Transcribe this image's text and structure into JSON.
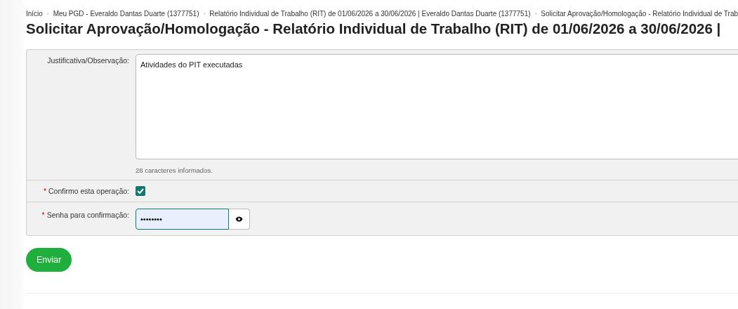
{
  "breadcrumb": [
    "Início",
    "Meu PGD - Everaldo Dantas Duarte (1377751)",
    "Relatório Individual de Trabalho (RIT) de 01/06/2026 a 30/06/2026 | Everaldo Dantas Duarte (1377751)",
    "Solicitar Aprovação/Homologação - Relatório Individual de Trab"
  ],
  "title": "Solicitar Aprovação/Homologação - Relatório Individual de Trabalho (RIT) de 01/06/2026 a 30/06/2026 |",
  "form": {
    "justification": {
      "label": "Justificativa/Observação:",
      "value": "Atividades do PIT executadas",
      "counter": "28 caracteres informados."
    },
    "confirm": {
      "label": "Confirmo esta operação:",
      "required_mark": "*",
      "checked": true
    },
    "password": {
      "label": "Senha para confirmação:",
      "required_mark": "*",
      "value": "••••••••"
    }
  },
  "submit": "Enviar"
}
